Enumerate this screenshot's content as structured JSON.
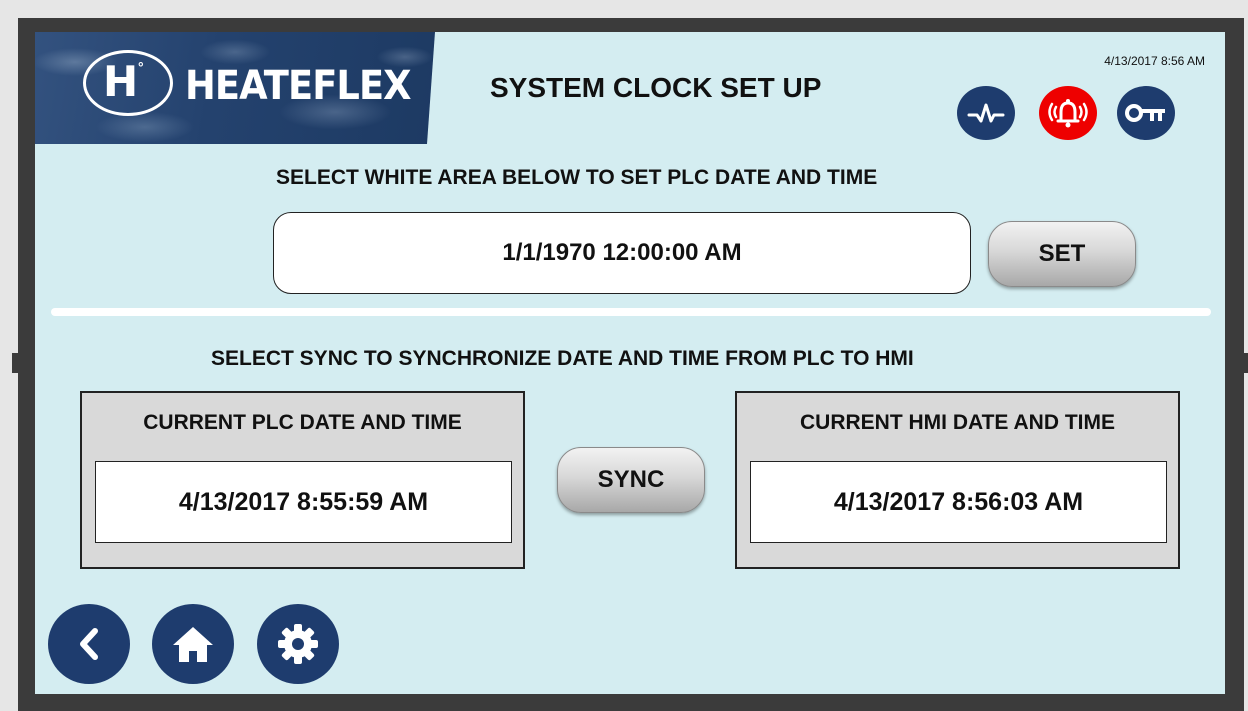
{
  "brand": {
    "name": "HEATEFLEX",
    "mark": "H",
    "mark_degree": "°"
  },
  "header": {
    "title": "SYSTEM CLOCK SET UP",
    "timestamp": "4/13/2017 8:56 AM",
    "buttons": [
      {
        "icon": "trend-pulse-icon"
      },
      {
        "icon": "alarm-bell-icon",
        "color": "#ee0000"
      },
      {
        "icon": "key-icon"
      }
    ]
  },
  "set_section": {
    "instruction": "SELECT WHITE AREA BELOW TO SET PLC DATE AND TIME",
    "entry_value": "1/1/1970 12:00:00 AM",
    "set_label": "SET"
  },
  "sync_section": {
    "instruction": "SELECT SYNC TO SYNCHRONIZE DATE AND TIME FROM PLC TO HMI",
    "sync_label": "SYNC",
    "plc_panel": {
      "title": "CURRENT PLC DATE AND TIME",
      "value": "4/13/2017 8:55:59 AM"
    },
    "hmi_panel": {
      "title": "CURRENT HMI DATE AND TIME",
      "value": "4/13/2017 8:56:03 AM"
    }
  },
  "footer_nav": [
    {
      "icon": "back-chevron-icon"
    },
    {
      "icon": "home-icon"
    },
    {
      "icon": "gear-icon"
    }
  ],
  "colors": {
    "screen_bg": "#d4edf1",
    "button_navy": "#1e3c6e",
    "alarm_red": "#ee0000",
    "bezel": "#3b3b3b"
  }
}
